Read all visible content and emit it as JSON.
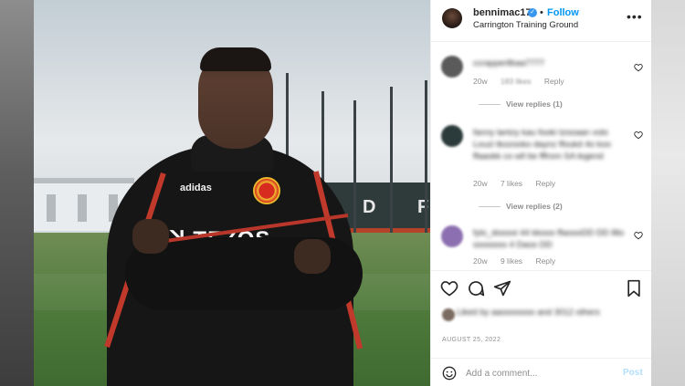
{
  "post": {
    "username": "bennimac17",
    "follow_label": "Follow",
    "separator": "•",
    "location": "Carrington Training Ground",
    "more_label": "•••",
    "verified_mark": "✓"
  },
  "comments": [
    {
      "text": "ccrapperllbaa7777",
      "time": "20w",
      "likes": "183 likes",
      "reply": "Reply",
      "view_replies": "View replies (1)",
      "avatar_color": "#5a5a5a"
    },
    {
      "text": "fanny lantzy kau fooki tzooaan volo Louzi tkozooko daynz ffoukd 4o koo ffaaokk co wll be fffrom SA legend",
      "time": "20w",
      "likes": "7 likes",
      "reply": "Reply",
      "view_replies": "View replies (2)",
      "avatar_color": "#2b3a3a"
    },
    {
      "text": "fylo_dooooi 44 kkooo ffaoooDD DD llllo ooooooo 4 Daoo DD",
      "time": "20w",
      "likes": "9 likes",
      "reply": "Reply",
      "avatar_color": "#8c6fb0"
    }
  ],
  "likes_text": "Liked by aaooooooo and 3012 others",
  "date": "AUGUST 25, 2022",
  "comment_box": {
    "placeholder": "Add a comment...",
    "post_label": "Post"
  },
  "photo": {
    "sponsor_text": "ꓘ TEZOS",
    "brand_text": "adidas",
    "stand_letters": [
      "D",
      "F"
    ]
  },
  "colors": {
    "follow_blue": "#0095f6",
    "post_disabled": "#b2dffc",
    "verified_blue": "#3897f0",
    "jersey_red": "#c0392b"
  }
}
